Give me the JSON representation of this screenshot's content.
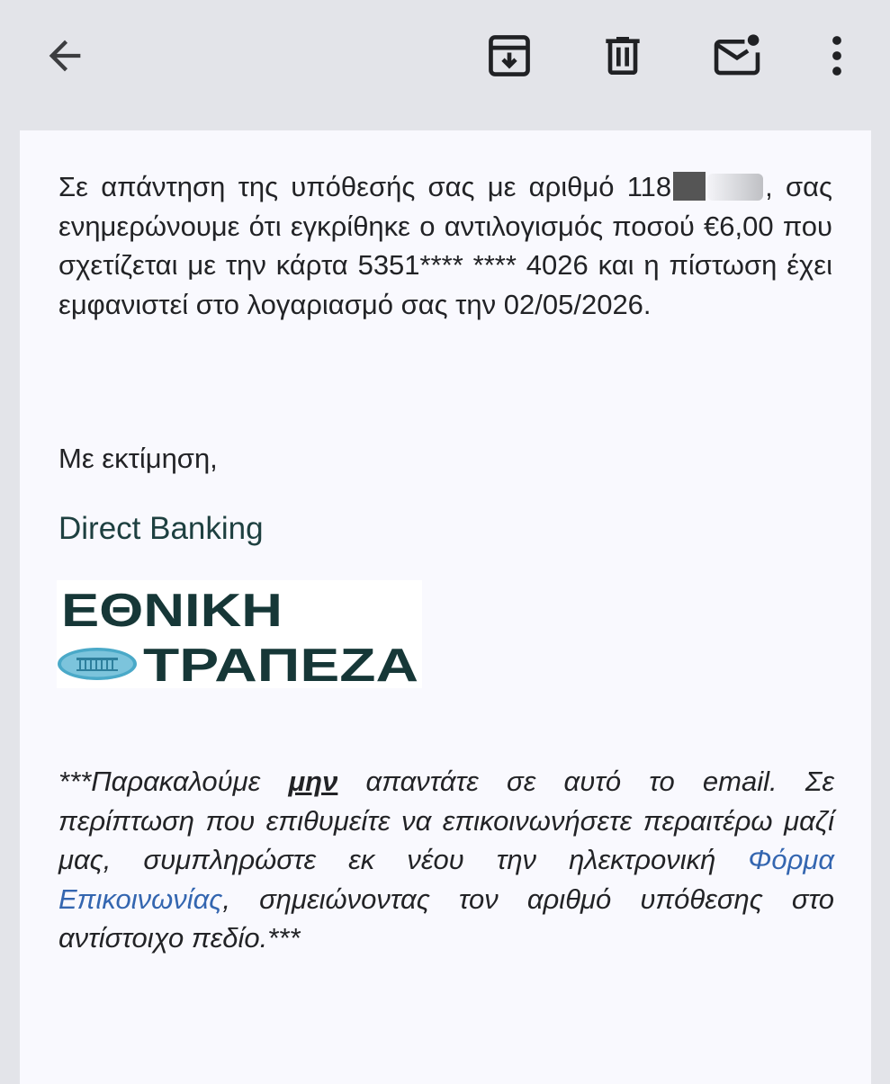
{
  "toolbar": {
    "back_icon": "arrow-left-icon",
    "archive_icon": "archive-icon",
    "delete_icon": "trash-icon",
    "unread_icon": "mark-unread-icon",
    "more_icon": "more-vert-icon"
  },
  "message": {
    "para1_part1": "Σε απάντηση της υπόθεσής σας με αριθμό 118",
    "para1_part2": ", σας ενημερώνουμε ότι εγκρίθηκε ο αντιλογισμός ποσού €6,00 που σχετίζεται με την κάρτα 5351**** **** 4026 και η πίστωση έχει εμφανιστεί στο λογαριασμό σας την 02/05/2026.",
    "closing": "Με εκτίμηση,",
    "sender": "Direct Banking",
    "logo_line1": "ΕΘΝΙΚΗ",
    "logo_line2": "ΤΡΑΠΕΖΑ",
    "notice_part1": "***Παρακαλούμε ",
    "notice_emph": "μην",
    "notice_part2": " απαντάτε σε αυτό το email. Σε περίπτωση που επιθυμείτε να επικοινωνήσετε περαιτέρω μαζί μας, συμπληρώστε εκ νέου την ηλεκτρονική ",
    "notice_link": "Φόρμα Επικοινωνίας",
    "notice_part3": ", σημειώνοντας τον αριθμό υπόθεσης στο αντίστοιχο πεδίο.***"
  },
  "colors": {
    "toolbar_bg": "#e3e4e9",
    "sheet_bg": "#f9f9fe",
    "text": "#222326",
    "sender": "#1e4040",
    "link": "#3466b0",
    "logo_text": "#163737",
    "logo_emblem": "#4aa9c8"
  }
}
